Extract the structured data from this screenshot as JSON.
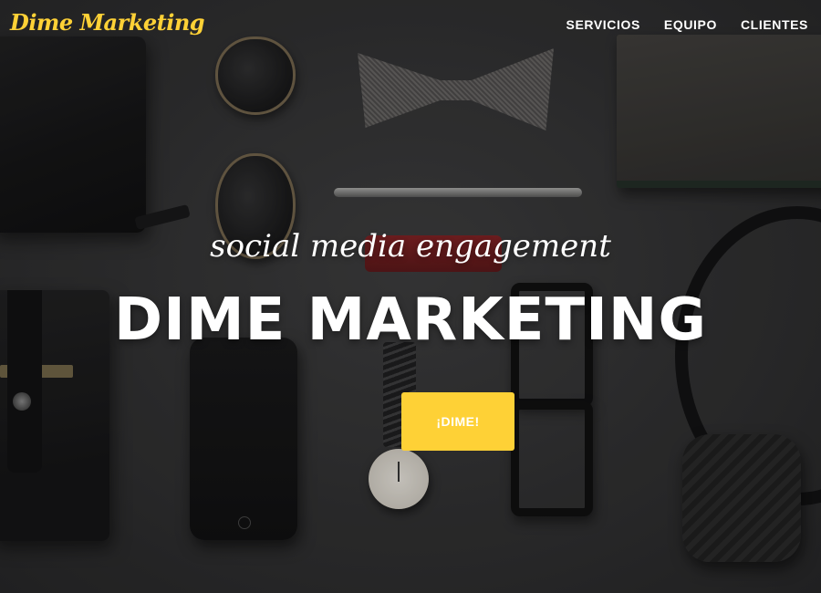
{
  "navbar": {
    "brand": "Dime Marketing",
    "links": [
      "SERVICIOS",
      "EQUIPO",
      "CLIENTES"
    ]
  },
  "hero": {
    "lead_in": "social media engagement",
    "heading": "DIME MARKETING",
    "cta_label": "¡DIME!"
  },
  "colors": {
    "accent": "#fed136",
    "text": "#ffffff",
    "background": "#2f2f30"
  },
  "background_image": {
    "icons": [
      "wallet-icon",
      "sunglasses-icon",
      "bowtie-icon",
      "pen-icon",
      "notebook-icon",
      "phone-icon",
      "watch-icon",
      "eyeglasses-icon",
      "headphones-icon"
    ]
  }
}
